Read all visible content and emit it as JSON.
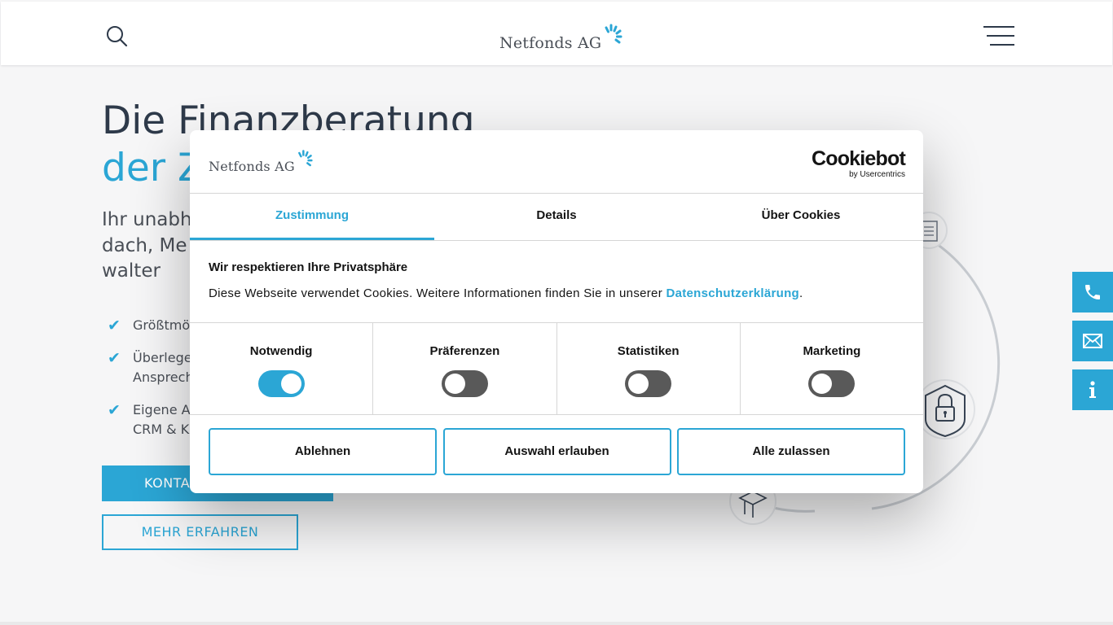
{
  "header": {
    "logo_text": "Netfonds AG",
    "search_icon": "search-icon",
    "menu_icon": "hamburger-menu-icon"
  },
  "hero": {
    "title_line1": "Die Finanzberatung",
    "title_line2": "der Z",
    "subtitle": "Ihr unabh dach, Me walter",
    "bullets": [
      {
        "line1": "Größtmö",
        "line2": ""
      },
      {
        "line1": "Überlege",
        "line2": "Ansprech"
      },
      {
        "line1": "Eigene A",
        "line2": "CRM & K"
      }
    ],
    "cta_primary": "KONTA",
    "cta_secondary": "MEHR ERFAHREN"
  },
  "side_tabs": [
    {
      "icon": "phone-icon"
    },
    {
      "icon": "mail-icon"
    },
    {
      "icon": "info-icon"
    }
  ],
  "cookie": {
    "logo_text": "Netfonds AG",
    "provider_name": "Cookiebot",
    "provider_by": "by Usercentrics",
    "tabs": [
      {
        "label": "Zustimmung",
        "active": true
      },
      {
        "label": "Details",
        "active": false
      },
      {
        "label": "Über Cookies",
        "active": false
      }
    ],
    "body_title": "Wir respektieren Ihre Privatsphäre",
    "body_text": "Diese Webseite verwendet Cookies. Weitere Informationen finden Sie in unserer ",
    "body_link": "Datenschutzerklärung",
    "body_text_end": ".",
    "categories": [
      {
        "label": "Notwendig",
        "enabled": true
      },
      {
        "label": "Präferenzen",
        "enabled": false
      },
      {
        "label": "Statistiken",
        "enabled": false
      },
      {
        "label": "Marketing",
        "enabled": false
      }
    ],
    "buttons": {
      "reject": "Ablehnen",
      "allow_selection": "Auswahl erlauben",
      "allow_all": "Alle zulassen"
    }
  },
  "colors": {
    "accent": "#2ba6d5",
    "text_dark": "#2e3a4a",
    "background": "#f6f6f7"
  }
}
